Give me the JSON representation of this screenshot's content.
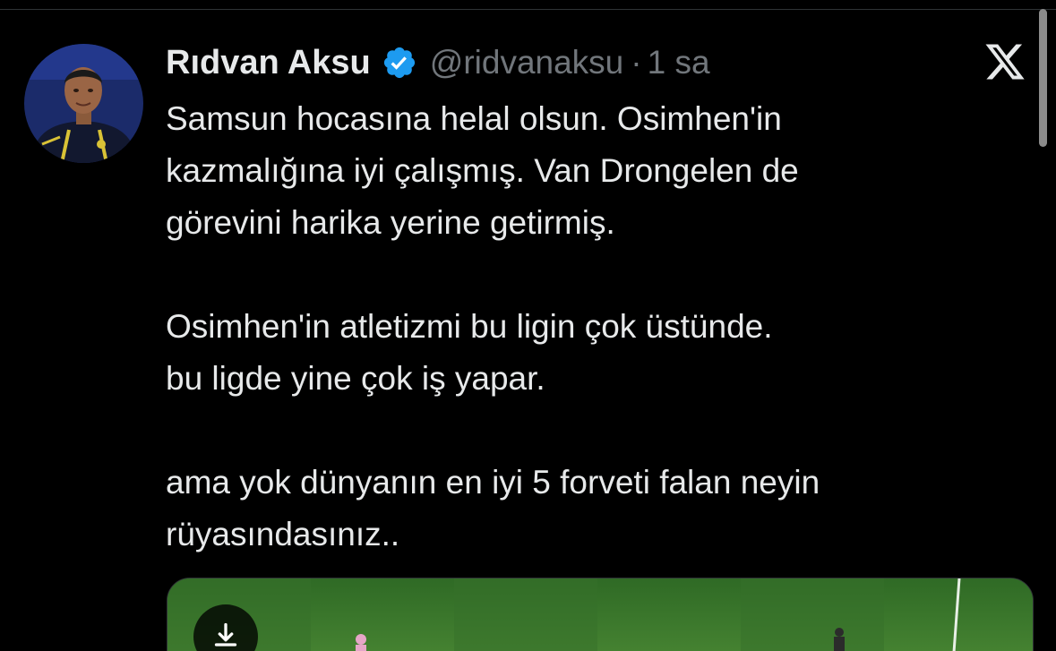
{
  "tweet": {
    "author": {
      "display_name": "Rıdvan Aksu",
      "handle": "@ridvanaksu",
      "verified": true,
      "avatar_icon": "profile-photo"
    },
    "separator": "·",
    "time": "1 sa",
    "text_paragraphs": [
      [
        "Samsun hocasına helal olsun. Osimhen'in",
        "kazmalığına iyi çalışmış. Van Drongelen de",
        "görevini harika yerine getirmiş."
      ],
      [
        "Osimhen'in atletizmi bu ligin çok üstünde.",
        "bu ligde yine çok iş yapar."
      ],
      [
        "ama yok dünyanın en iyi 5 forveti falan neyin",
        "rüyasındasınız.."
      ]
    ],
    "media": {
      "type": "video-thumbnail",
      "icon": "download-icon"
    }
  },
  "icons": {
    "platform": "x-logo-icon",
    "verified": "verified-badge-icon"
  },
  "colors": {
    "background": "#000000",
    "text_primary": "#e7e9ea",
    "text_secondary": "#71767b",
    "verified_blue": "#1d9bf0"
  }
}
